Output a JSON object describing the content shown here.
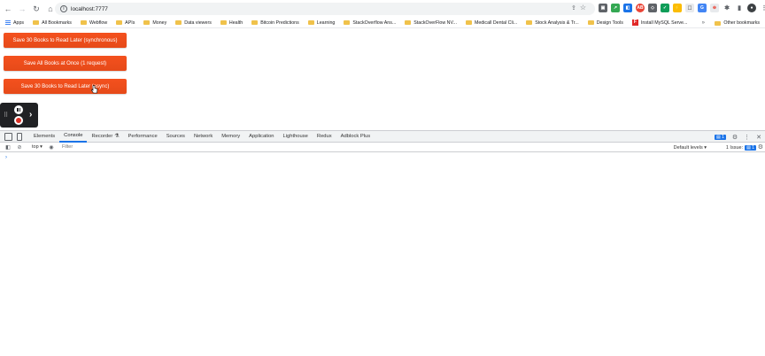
{
  "browser": {
    "url": "localhost:7777",
    "bookmarks": [
      {
        "label": "Apps",
        "type": "apps"
      },
      {
        "label": "All Bookmarks",
        "type": "folder"
      },
      {
        "label": "Webflow",
        "type": "folder"
      },
      {
        "label": "APIs",
        "type": "folder"
      },
      {
        "label": "Money",
        "type": "folder"
      },
      {
        "label": "Data viewers",
        "type": "folder"
      },
      {
        "label": "Health",
        "type": "folder"
      },
      {
        "label": "Bitcoin Predictions",
        "type": "folder"
      },
      {
        "label": "Learning",
        "type": "folder"
      },
      {
        "label": "StackOverflow Ans...",
        "type": "folder"
      },
      {
        "label": "StackOverFlow NV...",
        "type": "folder"
      },
      {
        "label": "Medicall Dental Cli...",
        "type": "folder"
      },
      {
        "label": "Stock Analysis & Tr...",
        "type": "folder"
      },
      {
        "label": "Design Tools",
        "type": "folder"
      },
      {
        "label": "Install MySQL Serve...",
        "type": "link"
      }
    ],
    "other_bookmarks": "Other bookmarks"
  },
  "page": {
    "buttons": [
      "Save 30 Books to Read Later (synchronous)",
      "Save All Books at Once (1 request)",
      "Save 30 Books to Read Later (async)"
    ]
  },
  "devtools": {
    "tabs": [
      "Elements",
      "Console",
      "Recorder",
      "Performance",
      "Sources",
      "Network",
      "Memory",
      "Application",
      "Lighthouse",
      "Redux",
      "Adblock Plus"
    ],
    "active_tab": "Console",
    "messages_badge": "1",
    "context": "top",
    "filter_placeholder": "Filter",
    "levels": "Default levels",
    "issues_label": "1 Issue:",
    "issues_count": "1",
    "prompt": "›"
  },
  "colors": {
    "button": "#f4511e",
    "accent": "#1a73e8"
  }
}
